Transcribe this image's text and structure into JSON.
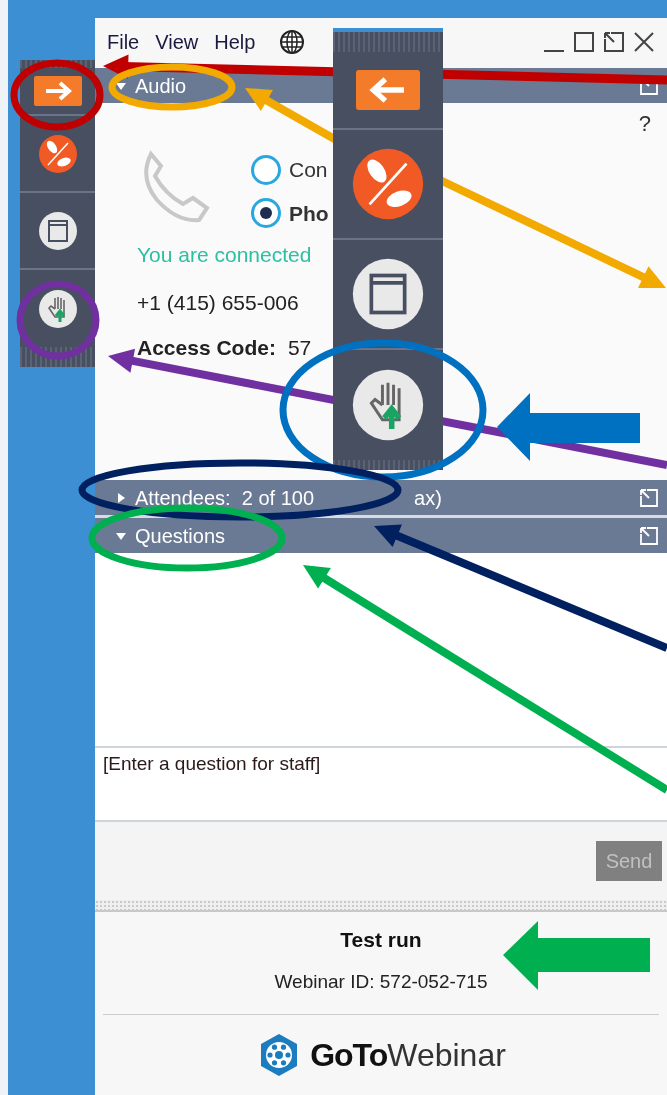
{
  "menu_bar": {
    "items": [
      "File",
      "View",
      "Help"
    ]
  },
  "audio": {
    "title": "Audio",
    "expanded": true,
    "help": "?",
    "options": [
      {
        "label": "Con",
        "selected": false
      },
      {
        "label": "Pho",
        "selected": true
      }
    ],
    "status": "You are connected",
    "phone": "+1 (415) 655-006",
    "access_label": "Access Code:",
    "access_value": "57"
  },
  "attendees": {
    "title": "Attendees:  2 of 100",
    "title_tail": "ax)",
    "expanded": false
  },
  "questions": {
    "title": "Questions",
    "expanded": true,
    "placeholder": "[Enter a question for staff]",
    "send": {
      "label": "Send",
      "disabled": true
    }
  },
  "footer": {
    "title": "Test run",
    "webinar_id": "Webinar ID: 572-052-715",
    "brand_bold": "GoTo",
    "brand_light": "Webinar"
  }
}
